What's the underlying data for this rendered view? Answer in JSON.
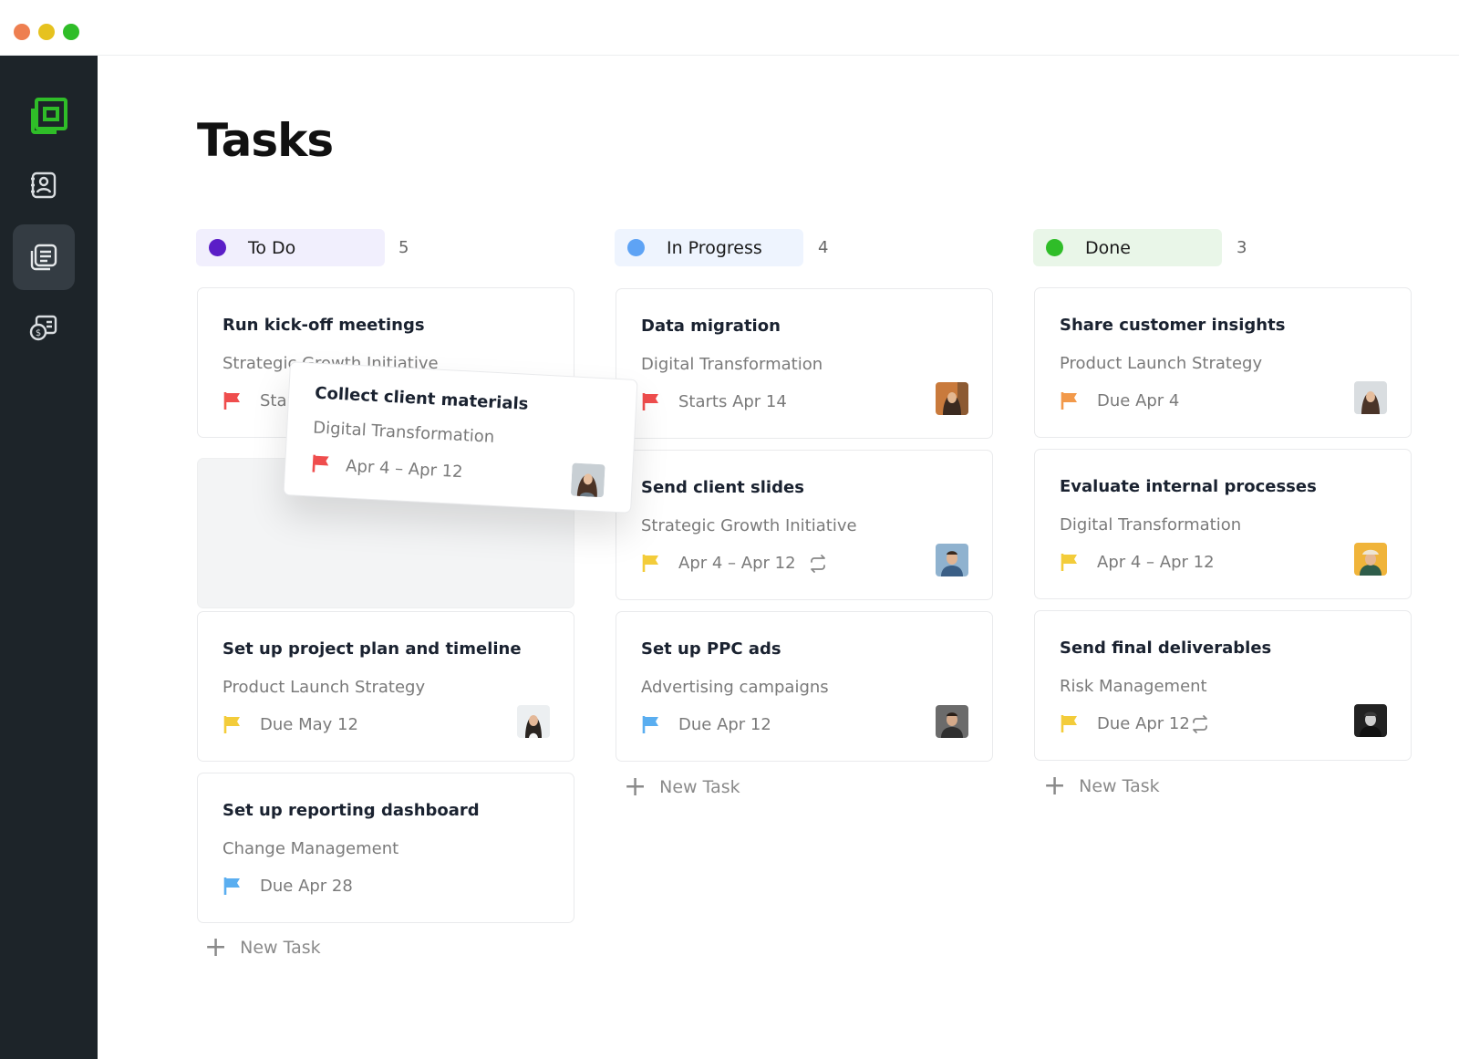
{
  "page": {
    "title": "Tasks"
  },
  "colors": {
    "todo": "#5b1ec7",
    "in_progress": "#5ea3f5",
    "done": "#2fbd28",
    "flag_red": "#ef4d4d",
    "flag_yellow": "#f3cc3a",
    "flag_blue": "#5aaef0",
    "flag_orange": "#f2994a"
  },
  "sidebar": {
    "items": [
      {
        "icon": "contacts-icon"
      },
      {
        "icon": "tasks-icon",
        "active": true
      },
      {
        "icon": "billing-icon"
      }
    ]
  },
  "columns": [
    {
      "label": "To Do",
      "count": "5",
      "cards": [
        {
          "title": "Run kick-off meetings",
          "project": "Strategic Growth Initiative",
          "date": "Starts Apr 14",
          "flag": "red"
        },
        {
          "title": "Set up project plan and timeline",
          "project": "Product Launch Strategy",
          "date": "Due May 12",
          "flag": "yellow"
        },
        {
          "title": "Set up reporting dashboard",
          "project": "Change Management",
          "date": "Due Apr 28",
          "flag": "blue"
        }
      ],
      "new_task": "New Task"
    },
    {
      "label": "In Progress",
      "count": "4",
      "cards": [
        {
          "title": "Data migration",
          "project": "Digital Transformation",
          "date": "Starts Apr 14",
          "flag": "red"
        },
        {
          "title": "Send client slides",
          "project": "Strategic Growth Initiative",
          "date": "Apr 4 – Apr 12",
          "flag": "yellow",
          "recurring": true
        },
        {
          "title": "Set up PPC ads",
          "project": "Advertising campaigns",
          "date": "Due Apr 12",
          "flag": "blue"
        }
      ],
      "new_task": "New Task"
    },
    {
      "label": "Done",
      "count": "3",
      "cards": [
        {
          "title": "Share customer insights",
          "project": "Product Launch Strategy",
          "date": "Due Apr 4",
          "flag": "orange"
        },
        {
          "title": "Evaluate internal processes",
          "project": "Digital Transformation",
          "date": "Apr 4 – Apr 12",
          "flag": "yellow"
        },
        {
          "title": "Send final deliverables",
          "project": "Risk Management",
          "date": "Due Apr 12",
          "flag": "yellow",
          "recurring": true
        }
      ],
      "new_task": "New Task"
    }
  ],
  "dragged_card": {
    "title": "Collect client materials",
    "project": "Digital Transformation",
    "date": "Apr 4 – Apr 12",
    "flag": "red"
  }
}
